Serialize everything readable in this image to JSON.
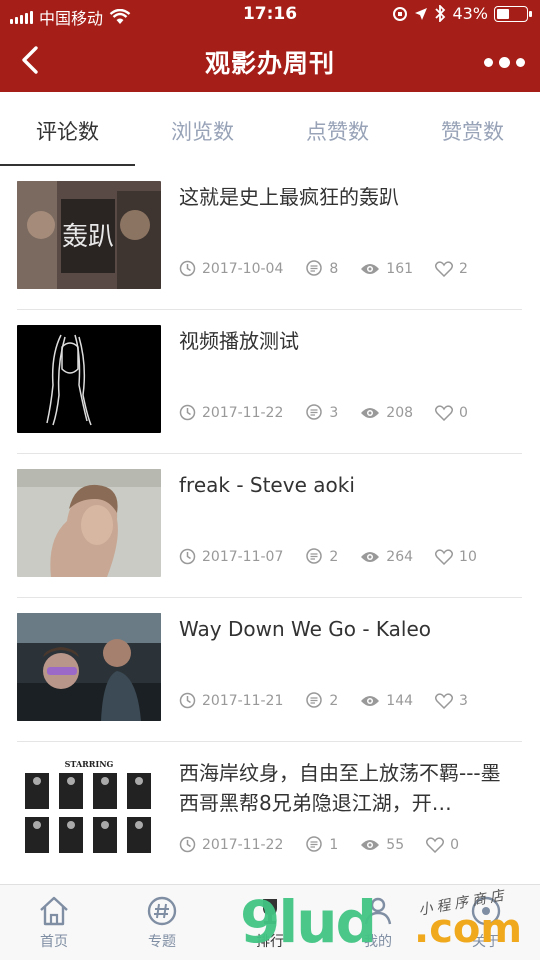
{
  "status_bar": {
    "carrier": "中国移动",
    "time": "17:16",
    "battery": "43%"
  },
  "header": {
    "title": "观影办周刊"
  },
  "tabs": [
    {
      "label": "评论数",
      "active": true
    },
    {
      "label": "浏览数",
      "active": false
    },
    {
      "label": "点赞数",
      "active": false
    },
    {
      "label": "赞赏数",
      "active": false
    }
  ],
  "items": [
    {
      "title": "这就是史上最疯狂的轰趴",
      "date": "2017-10-04",
      "comments": "8",
      "views": "161",
      "likes": "2",
      "thumb_label": "轰趴"
    },
    {
      "title": "视频播放测试",
      "date": "2017-11-22",
      "comments": "3",
      "views": "208",
      "likes": "0"
    },
    {
      "title": "freak - Steve aoki",
      "date": "2017-11-07",
      "comments": "2",
      "views": "264",
      "likes": "10"
    },
    {
      "title": "Way Down We Go - Kaleo",
      "date": "2017-11-21",
      "comments": "2",
      "views": "144",
      "likes": "3"
    },
    {
      "title": "西海岸纹身，自由至上放荡不羁---墨西哥黑帮8兄弟隐退江湖，开…",
      "date": "2017-11-22",
      "comments": "1",
      "views": "55",
      "likes": "0",
      "thumb_label": "STARRING"
    }
  ],
  "tabbar": [
    {
      "label": "首页",
      "icon": "home-icon"
    },
    {
      "label": "专题",
      "icon": "hashtag-icon"
    },
    {
      "label": "排行",
      "icon": "trophy-icon",
      "active": true
    },
    {
      "label": "我的",
      "icon": "user-icon"
    },
    {
      "label": "关于",
      "icon": "about-icon"
    }
  ],
  "watermark": {
    "main": "9lud",
    "com": ".com",
    "cn": "小程序商店"
  },
  "colors": {
    "brand": "#a51f18",
    "tab_inactive": "#98a3b8",
    "meta": "#999999"
  }
}
